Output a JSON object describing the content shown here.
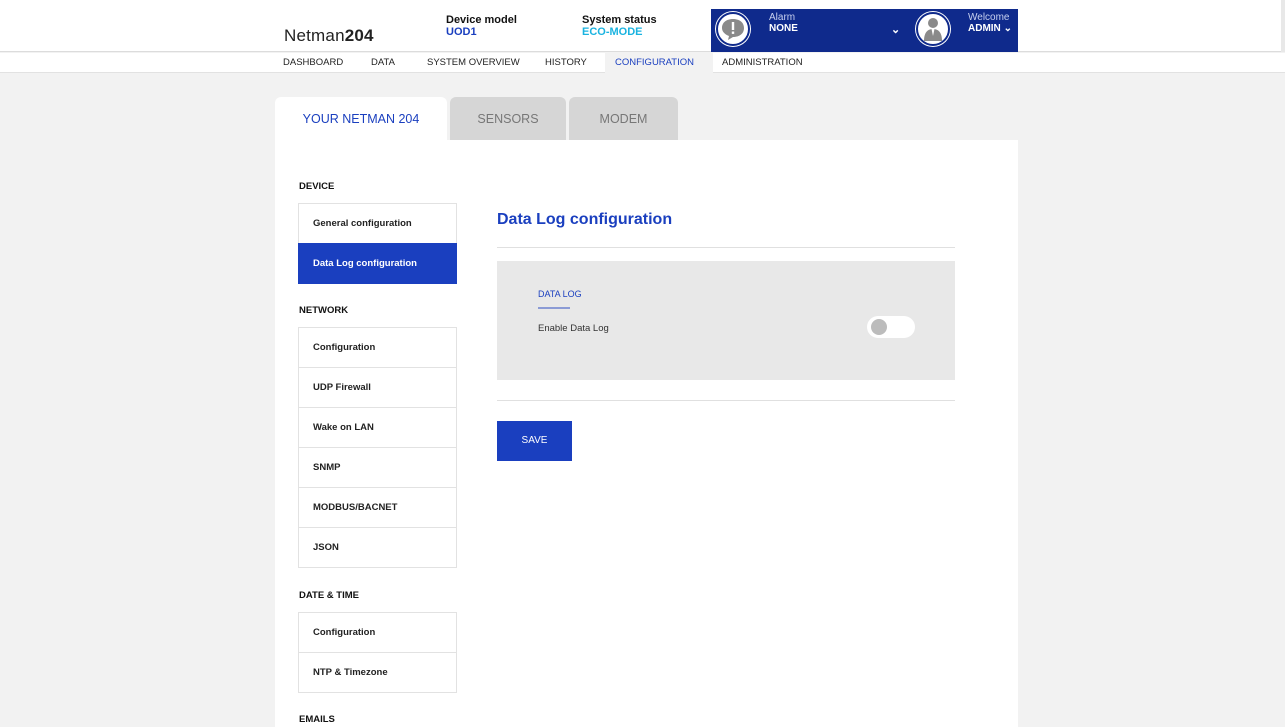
{
  "brand": {
    "prefix": "Netman",
    "suffix": "204"
  },
  "header": {
    "device_model_label": "Device model",
    "device_model_value": "UOD1",
    "system_status_label": "System status",
    "system_status_value": "ECO-MODE",
    "alarm_label": "Alarm",
    "alarm_value": "NONE",
    "welcome_label": "Welcome",
    "user": "ADMIN",
    "alarm_icon": "alarm-exclamation-icon",
    "user_icon": "user-avatar-icon"
  },
  "nav": {
    "items": [
      {
        "label": "DASHBOARD"
      },
      {
        "label": "DATA"
      },
      {
        "label": "SYSTEM OVERVIEW"
      },
      {
        "label": "HISTORY"
      },
      {
        "label": "CONFIGURATION"
      },
      {
        "label": "ADMINISTRATION"
      }
    ],
    "active": "CONFIGURATION"
  },
  "tabs": [
    {
      "label": "YOUR NETMAN 204"
    },
    {
      "label": "SENSORS"
    },
    {
      "label": "MODEM"
    }
  ],
  "sidebar": {
    "sections": [
      {
        "title": "DEVICE",
        "items": [
          "General configuration",
          "Data Log configuration"
        ]
      },
      {
        "title": "NETWORK",
        "items": [
          "Configuration",
          "UDP Firewall",
          "Wake on LAN",
          "SNMP",
          "MODBUS/BACNET",
          "JSON"
        ]
      },
      {
        "title": "DATE & TIME",
        "items": [
          "Configuration",
          "NTP & Timezone"
        ]
      },
      {
        "title": "EMAILS",
        "items": []
      }
    ],
    "active_item": "Data Log configuration"
  },
  "main": {
    "title": "Data Log configuration",
    "card_title": "DATA LOG",
    "enable_label": "Enable Data Log",
    "enable_value": false,
    "save_label": "SAVE"
  },
  "colors": {
    "accent": "#1a3fbf",
    "header_bar": "#0f2a8c",
    "status": "#1ab3e0"
  }
}
